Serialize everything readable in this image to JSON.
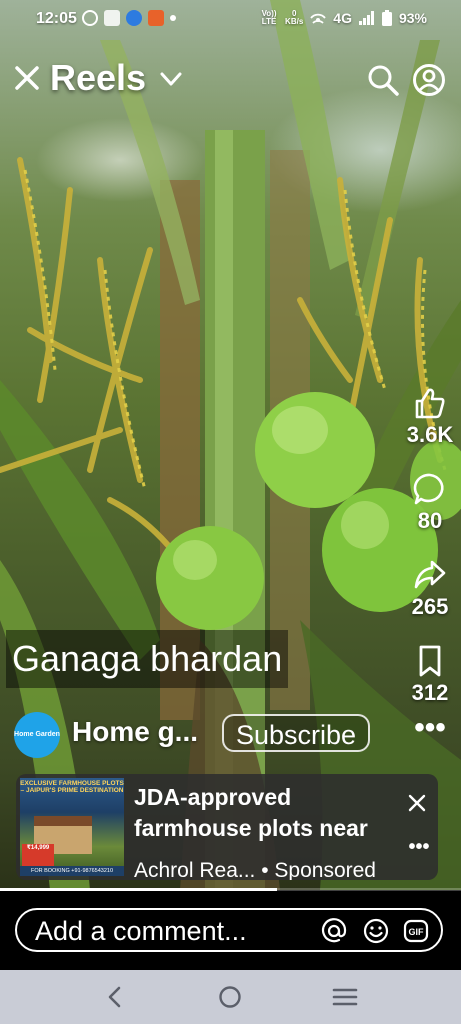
{
  "status_bar": {
    "time": "12:05",
    "volte": "Vo)) LTE",
    "speed_value": "0",
    "speed_unit": "KB/s",
    "network": "4G",
    "battery": "93%"
  },
  "header": {
    "title": "Reels"
  },
  "actions": {
    "likes": "3.6K",
    "comments": "80",
    "shares": "265",
    "saves": "312"
  },
  "reel": {
    "caption": "Ganaga bhardan",
    "page_name": "Home g...",
    "page_avatar_text": "Home Garden",
    "subscribe_label": "Subscribe",
    "progress": 0.6
  },
  "ad": {
    "headline": "JDA-approved farmhouse plots near MJRP University, Del...",
    "meta": "Achrol Rea... • Sponsored",
    "thumb_header": "EXCLUSIVE FARMHOUSE PLOTS – JAIPUR'S PRIME DESTINATION",
    "thumb_price": "₹14,999",
    "thumb_footer": "FOR BOOKING +91-9876543210"
  },
  "comment": {
    "placeholder": "Add a comment..."
  },
  "colors": {
    "page_avatar": "#1fa3e8",
    "nav_bar": "#c9ccd6"
  }
}
